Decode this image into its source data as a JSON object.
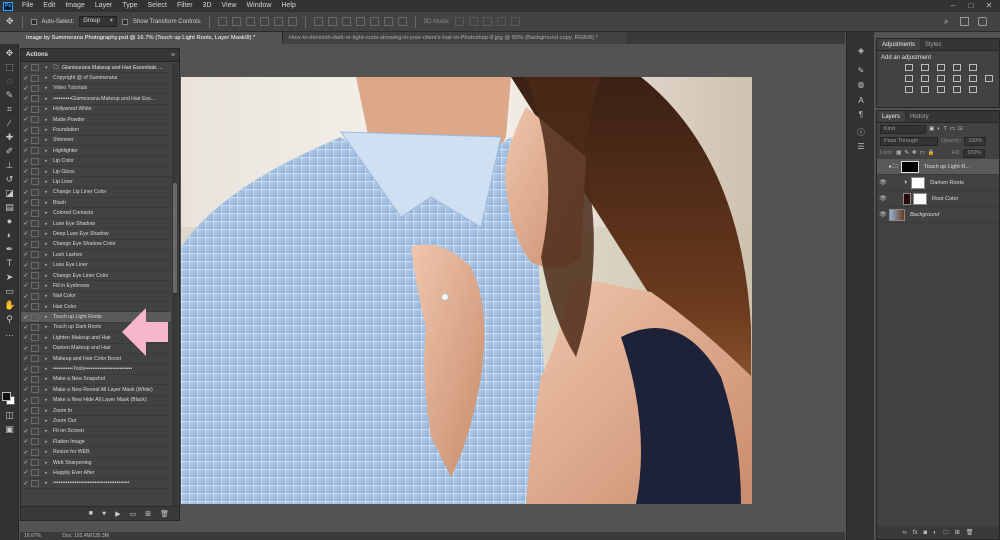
{
  "menubar": {
    "logo": "Ps",
    "items": [
      "File",
      "Edit",
      "Image",
      "Layer",
      "Type",
      "Select",
      "Filter",
      "3D",
      "View",
      "Window",
      "Help"
    ]
  },
  "options": {
    "auto_select_label": "Auto-Select:",
    "auto_select_value": "Group",
    "transform_controls_label": "Show Transform Controls",
    "mode_3d_label": "3D Mode:"
  },
  "tabs": [
    {
      "label": "Image by Summerana Photography.psd @ 16.7% (Touch up Light Roots, Layer Mask/8) *"
    },
    {
      "label": "How-to-diminish-dark-or-light-roots-showing-in-your-client's-hair-in-Photoshop-8.jpg @ 50% (Background copy, RGB/8) *"
    }
  ],
  "actions": {
    "title": "Actions",
    "items": [
      {
        "name": "Glamourana Makeup and Hair Essentials ...",
        "checked": true,
        "set": true
      },
      {
        "name": "Copyright @ of Summerana",
        "checked": true
      },
      {
        "name": "Video Tutorials",
        "checked": true
      },
      {
        "name": "••••••••••Glamourana Makeup and Hair Ess...",
        "checked": true
      },
      {
        "name": "Hollywood White",
        "checked": true
      },
      {
        "name": "Matte Powder",
        "checked": true
      },
      {
        "name": "Foundation",
        "checked": true
      },
      {
        "name": "Shimmer",
        "checked": true
      },
      {
        "name": "Highlighter",
        "checked": true
      },
      {
        "name": "Lip Color",
        "checked": true
      },
      {
        "name": "Lip Gloss",
        "checked": true
      },
      {
        "name": "Lip Liner",
        "checked": true
      },
      {
        "name": "Change Lip Liner Color",
        "checked": true
      },
      {
        "name": "Blush",
        "checked": true
      },
      {
        "name": "Colored Contacts",
        "checked": true
      },
      {
        "name": "Luxe Eye Shadow",
        "checked": true
      },
      {
        "name": "Deep Luxe Eye Shadow",
        "checked": true
      },
      {
        "name": "Change Eye Shadow Color",
        "checked": true
      },
      {
        "name": "Lush Lashes",
        "checked": true
      },
      {
        "name": "Luxe Eye Liner",
        "checked": true
      },
      {
        "name": "Change Eye Liner Color",
        "checked": true
      },
      {
        "name": "Fill in Eyebrows",
        "checked": true
      },
      {
        "name": "Nail Color",
        "checked": true
      },
      {
        "name": "Hair Color",
        "checked": true
      },
      {
        "name": "Touch up Light Roots",
        "checked": true,
        "selected": true
      },
      {
        "name": "Touch up Dark Roots",
        "checked": true
      },
      {
        "name": "Lighten Makeup and Hair",
        "checked": true
      },
      {
        "name": "Darken Makeup and Hair",
        "checked": true
      },
      {
        "name": "Makeup and Hair Color Boost",
        "checked": true
      },
      {
        "name": "•••••••••••Tools••••••••••••••••••••••••••",
        "checked": true
      },
      {
        "name": "Make a New Snapshot",
        "checked": true
      },
      {
        "name": "Make a New Reveal All Layer Mask (White)",
        "checked": true
      },
      {
        "name": "Make a New Hide All Layer Mask (Black)",
        "checked": true
      },
      {
        "name": "Zoom In",
        "checked": true
      },
      {
        "name": "Zoom Out",
        "checked": true
      },
      {
        "name": "Fit on Screen",
        "checked": true
      },
      {
        "name": "Flatten Image",
        "checked": true
      },
      {
        "name": "Resize for WEB",
        "checked": true
      },
      {
        "name": "Web Sharpening",
        "checked": true
      },
      {
        "name": "Happily Ever After",
        "checked": true
      },
      {
        "name": "••••••••••••••••••••••••••••••••••••••••••",
        "checked": true
      }
    ]
  },
  "status": {
    "zoom": "16.67%",
    "doc": "Doc: 102.4M/135.3M"
  },
  "adjustments": {
    "tabs": [
      "Adjustments",
      "Styles"
    ],
    "title": "Add an adjustment"
  },
  "layers": {
    "tabs": [
      "Layers",
      "History"
    ],
    "filter_label": "Kind",
    "blend_mode": "Pass Through",
    "opacity_label": "Opacity:",
    "opacity_value": "100%",
    "lock_label": "Lock:",
    "fill_label": "Fill:",
    "fill_value": "100%",
    "items": [
      {
        "name": "Touch up Light R...",
        "selected": true
      },
      {
        "name": "Darken Roots"
      },
      {
        "name": "Root Color"
      },
      {
        "name": "Background"
      }
    ]
  },
  "colors": {
    "accent": "#31a8ff",
    "pink_arrow": "#f7b6c9"
  }
}
